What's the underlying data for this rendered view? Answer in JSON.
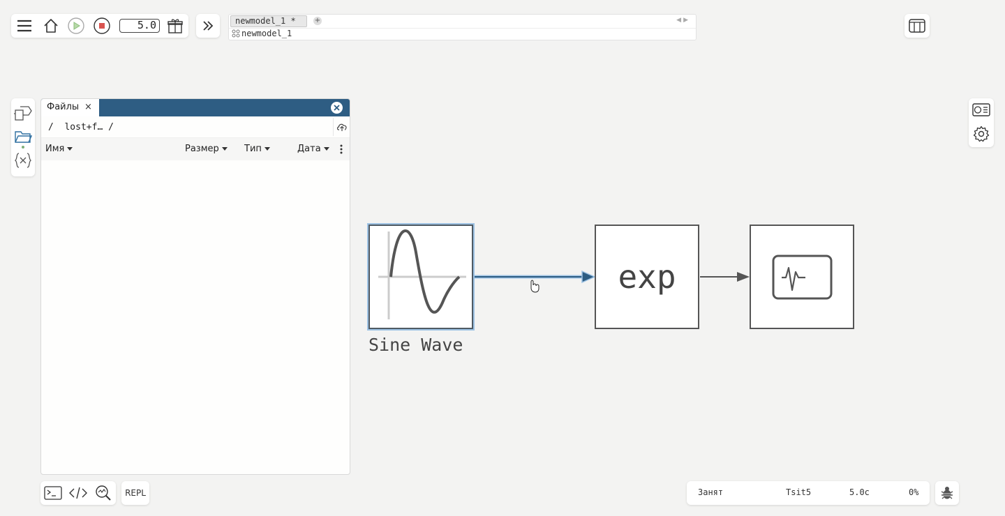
{
  "toolbar": {
    "duration": "5.0"
  },
  "tabs": {
    "active_tab": "newmodel_1 *",
    "add_symbol": "+",
    "breadcrumb": "newmodel_1"
  },
  "files_panel": {
    "tab_label": "Файлы",
    "tab_close": "×",
    "path": "/  lost+f… /",
    "columns": [
      "Имя",
      "Размер",
      "Тип",
      "Дата"
    ]
  },
  "diagram": {
    "blocks": [
      {
        "name": "Sine Wave",
        "label": "Sine Wave",
        "icon": "sine-wave-icon"
      },
      {
        "name": "exp",
        "label": "exp"
      },
      {
        "name": "scope",
        "icon": "scope-pulse-icon"
      }
    ],
    "colors": {
      "selection": "#9dc2e4",
      "signal": "#2e5d83",
      "block_border": "#555555"
    }
  },
  "bottom": {
    "repl_label": "REPL"
  },
  "status": {
    "state": "Занят",
    "solver": "Tsit5",
    "time": "5.0с",
    "progress": "0%"
  },
  "icons": [
    "menu-icon",
    "home-icon",
    "play-icon",
    "stop-icon",
    "package-icon",
    "double-chevron-right-icon",
    "layout-columns-icon",
    "block-library-icon",
    "folder-icon",
    "variables-icon",
    "upload-icon",
    "more-vertical-icon",
    "terminal-icon",
    "code-icon",
    "search-plot-icon",
    "bug-icon",
    "monitor-icon",
    "gear-icon"
  ]
}
